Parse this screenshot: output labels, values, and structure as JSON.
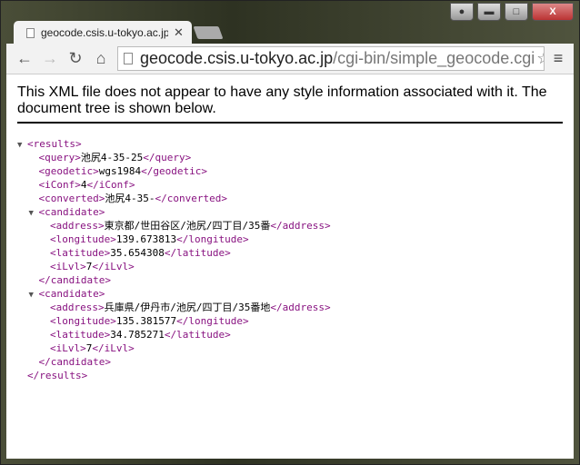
{
  "browser": {
    "tab_title": "geocode.csis.u-tokyo.ac.jp",
    "url_host": "geocode.csis.u-tokyo.ac.jp",
    "url_path": "/cgi-bin/simple_geocode.cgi"
  },
  "page": {
    "info": "This XML file does not appear to have any style information associated with it. The document tree is shown below."
  },
  "colors": {
    "tag": "#881280",
    "text": "#000000"
  },
  "tree": {
    "tag": "results",
    "children": [
      {
        "tag": "query",
        "text": "池尻4-35-25"
      },
      {
        "tag": "geodetic",
        "text": "wgs1984"
      },
      {
        "tag": "iConf",
        "text": "4"
      },
      {
        "tag": "converted",
        "text": "池尻4-35-"
      },
      {
        "tag": "candidate",
        "children": [
          {
            "tag": "address",
            "text": "東京都/世田谷区/池尻/四丁目/35番"
          },
          {
            "tag": "longitude",
            "text": "139.673813"
          },
          {
            "tag": "latitude",
            "text": "35.654308"
          },
          {
            "tag": "iLvl",
            "text": "7"
          }
        ]
      },
      {
        "tag": "candidate",
        "children": [
          {
            "tag": "address",
            "text": "兵庫県/伊丹市/池尻/四丁目/35番地"
          },
          {
            "tag": "longitude",
            "text": "135.381577"
          },
          {
            "tag": "latitude",
            "text": "34.785271"
          },
          {
            "tag": "iLvl",
            "text": "7"
          }
        ]
      }
    ]
  }
}
